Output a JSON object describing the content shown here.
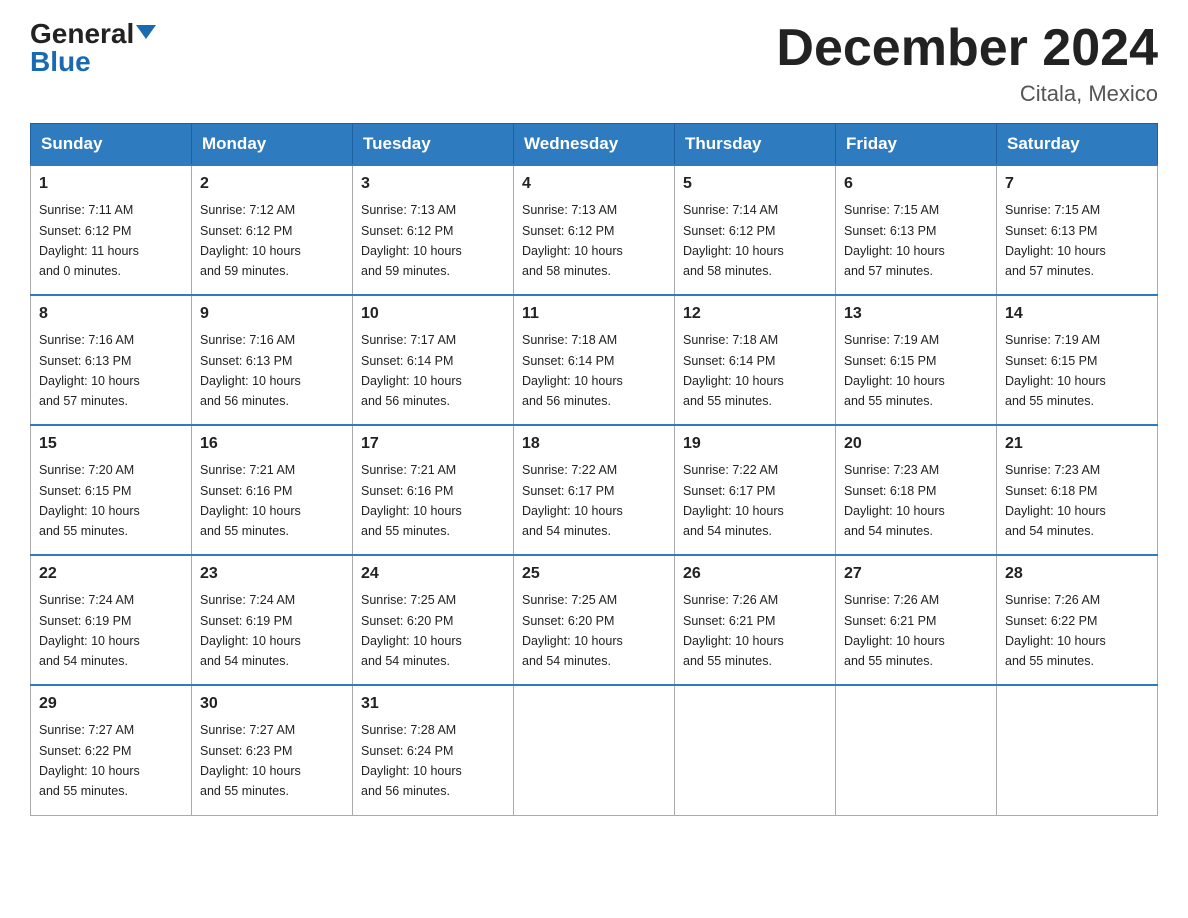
{
  "logo": {
    "general": "General",
    "blue": "Blue"
  },
  "title": "December 2024",
  "location": "Citala, Mexico",
  "days_of_week": [
    "Sunday",
    "Monday",
    "Tuesday",
    "Wednesday",
    "Thursday",
    "Friday",
    "Saturday"
  ],
  "weeks": [
    [
      {
        "day": "1",
        "sunrise": "7:11 AM",
        "sunset": "6:12 PM",
        "daylight": "11 hours and 0 minutes."
      },
      {
        "day": "2",
        "sunrise": "7:12 AM",
        "sunset": "6:12 PM",
        "daylight": "10 hours and 59 minutes."
      },
      {
        "day": "3",
        "sunrise": "7:13 AM",
        "sunset": "6:12 PM",
        "daylight": "10 hours and 59 minutes."
      },
      {
        "day": "4",
        "sunrise": "7:13 AM",
        "sunset": "6:12 PM",
        "daylight": "10 hours and 58 minutes."
      },
      {
        "day": "5",
        "sunrise": "7:14 AM",
        "sunset": "6:12 PM",
        "daylight": "10 hours and 58 minutes."
      },
      {
        "day": "6",
        "sunrise": "7:15 AM",
        "sunset": "6:13 PM",
        "daylight": "10 hours and 57 minutes."
      },
      {
        "day": "7",
        "sunrise": "7:15 AM",
        "sunset": "6:13 PM",
        "daylight": "10 hours and 57 minutes."
      }
    ],
    [
      {
        "day": "8",
        "sunrise": "7:16 AM",
        "sunset": "6:13 PM",
        "daylight": "10 hours and 57 minutes."
      },
      {
        "day": "9",
        "sunrise": "7:16 AM",
        "sunset": "6:13 PM",
        "daylight": "10 hours and 56 minutes."
      },
      {
        "day": "10",
        "sunrise": "7:17 AM",
        "sunset": "6:14 PM",
        "daylight": "10 hours and 56 minutes."
      },
      {
        "day": "11",
        "sunrise": "7:18 AM",
        "sunset": "6:14 PM",
        "daylight": "10 hours and 56 minutes."
      },
      {
        "day": "12",
        "sunrise": "7:18 AM",
        "sunset": "6:14 PM",
        "daylight": "10 hours and 55 minutes."
      },
      {
        "day": "13",
        "sunrise": "7:19 AM",
        "sunset": "6:15 PM",
        "daylight": "10 hours and 55 minutes."
      },
      {
        "day": "14",
        "sunrise": "7:19 AM",
        "sunset": "6:15 PM",
        "daylight": "10 hours and 55 minutes."
      }
    ],
    [
      {
        "day": "15",
        "sunrise": "7:20 AM",
        "sunset": "6:15 PM",
        "daylight": "10 hours and 55 minutes."
      },
      {
        "day": "16",
        "sunrise": "7:21 AM",
        "sunset": "6:16 PM",
        "daylight": "10 hours and 55 minutes."
      },
      {
        "day": "17",
        "sunrise": "7:21 AM",
        "sunset": "6:16 PM",
        "daylight": "10 hours and 55 minutes."
      },
      {
        "day": "18",
        "sunrise": "7:22 AM",
        "sunset": "6:17 PM",
        "daylight": "10 hours and 54 minutes."
      },
      {
        "day": "19",
        "sunrise": "7:22 AM",
        "sunset": "6:17 PM",
        "daylight": "10 hours and 54 minutes."
      },
      {
        "day": "20",
        "sunrise": "7:23 AM",
        "sunset": "6:18 PM",
        "daylight": "10 hours and 54 minutes."
      },
      {
        "day": "21",
        "sunrise": "7:23 AM",
        "sunset": "6:18 PM",
        "daylight": "10 hours and 54 minutes."
      }
    ],
    [
      {
        "day": "22",
        "sunrise": "7:24 AM",
        "sunset": "6:19 PM",
        "daylight": "10 hours and 54 minutes."
      },
      {
        "day": "23",
        "sunrise": "7:24 AM",
        "sunset": "6:19 PM",
        "daylight": "10 hours and 54 minutes."
      },
      {
        "day": "24",
        "sunrise": "7:25 AM",
        "sunset": "6:20 PM",
        "daylight": "10 hours and 54 minutes."
      },
      {
        "day": "25",
        "sunrise": "7:25 AM",
        "sunset": "6:20 PM",
        "daylight": "10 hours and 54 minutes."
      },
      {
        "day": "26",
        "sunrise": "7:26 AM",
        "sunset": "6:21 PM",
        "daylight": "10 hours and 55 minutes."
      },
      {
        "day": "27",
        "sunrise": "7:26 AM",
        "sunset": "6:21 PM",
        "daylight": "10 hours and 55 minutes."
      },
      {
        "day": "28",
        "sunrise": "7:26 AM",
        "sunset": "6:22 PM",
        "daylight": "10 hours and 55 minutes."
      }
    ],
    [
      {
        "day": "29",
        "sunrise": "7:27 AM",
        "sunset": "6:22 PM",
        "daylight": "10 hours and 55 minutes."
      },
      {
        "day": "30",
        "sunrise": "7:27 AM",
        "sunset": "6:23 PM",
        "daylight": "10 hours and 55 minutes."
      },
      {
        "day": "31",
        "sunrise": "7:28 AM",
        "sunset": "6:24 PM",
        "daylight": "10 hours and 56 minutes."
      },
      null,
      null,
      null,
      null
    ]
  ],
  "labels": {
    "sunrise": "Sunrise:",
    "sunset": "Sunset:",
    "daylight": "Daylight:"
  }
}
